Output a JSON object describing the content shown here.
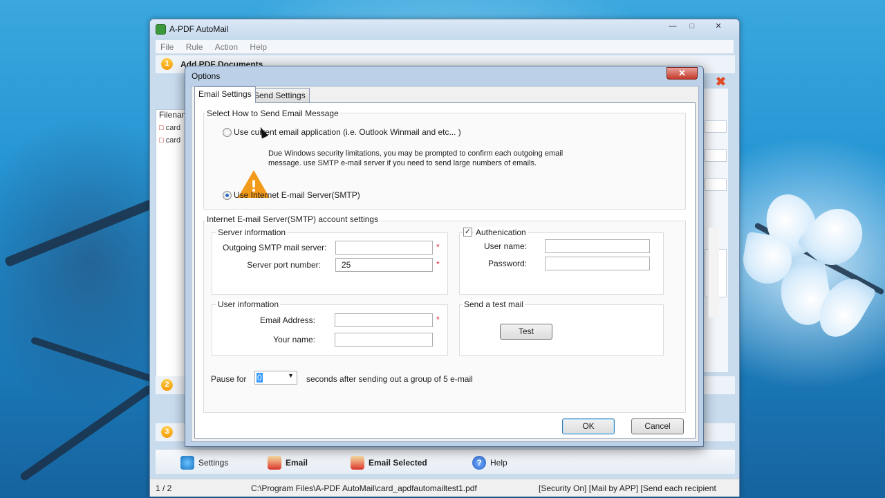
{
  "app": {
    "title": "A-PDF AutoMail",
    "menu": [
      "File",
      "Rule",
      "Action",
      "Help"
    ],
    "steps": [
      {
        "num": "1",
        "label": "Add PDF Documents"
      },
      {
        "num": "2",
        "label": ""
      },
      {
        "num": "3",
        "label": ""
      }
    ],
    "file_list": {
      "header": "Filenam",
      "items": [
        "card",
        "card"
      ]
    },
    "toolbar": {
      "settings": "Settings",
      "email": "Email",
      "email_selected": "Email Selected",
      "help": "Help"
    },
    "status": {
      "count": "1 / 2",
      "path": "C:\\Program Files\\A-PDF AutoMail\\card_apdfautomailtest1.pdf",
      "mode": "[Security On] [Mail by APP] [Send each recipient"
    }
  },
  "dialog": {
    "title": "Options",
    "tabs": [
      "Email Settings",
      "Send Settings"
    ],
    "send_method": {
      "heading": "Select How to Send Email Message",
      "option_client": "Use current email application (i.e. Outlook Winmail and etc... )",
      "warning_line1": "Due Windows security limitations,  you may be prompted to confirm each outgoing email",
      "warning_line2": "message. use SMTP e-mail server if you need to send large numbers of emails.",
      "option_smtp": "Use Internet E-mail Server(SMTP)",
      "selected": "smtp"
    },
    "smtp": {
      "heading": "Internet E-mail Server(SMTP) account settings",
      "server_info": "Server information",
      "outgoing_label": "Outgoing SMTP mail server:",
      "outgoing_value": "",
      "port_label": "Server port number:",
      "port_value": "25",
      "auth_label": "Authenication",
      "auth_checked": true,
      "user_label": "User name:",
      "user_value": "",
      "password_label": "Password:",
      "password_value": "",
      "user_info": "User information",
      "email_label": "Email Address:",
      "email_value": "",
      "name_label": "Your name:",
      "name_value": "",
      "test_heading": "Send a test mail",
      "test_button": "Test",
      "required_mark": "*"
    },
    "pause": {
      "label": "Pause for",
      "value": "0",
      "suffix": "seconds after sending out a group of 5 e-mail"
    },
    "ok": "OK",
    "cancel": "Cancel"
  }
}
